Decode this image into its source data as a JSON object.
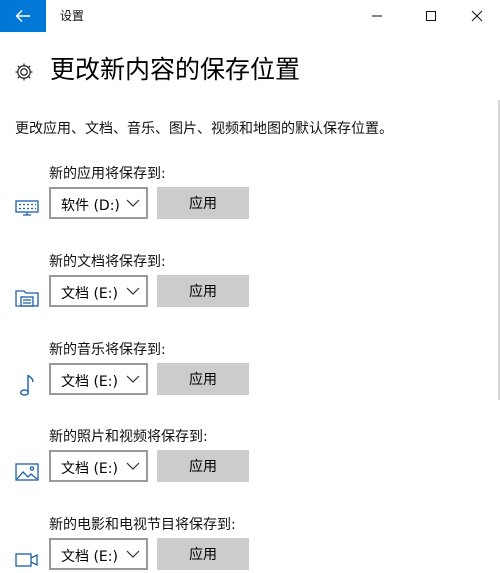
{
  "window": {
    "title": "设置",
    "controls": [
      "minimize-icon",
      "maximize-icon",
      "close-icon"
    ]
  },
  "page": {
    "title": "更改新内容的保存位置",
    "description": "更改应用、文档、音乐、图片、视频和地图的默认保存位置。"
  },
  "sections": [
    {
      "label": "新的应用将保存到:",
      "drive": "软件 (D:)",
      "apply": "应用",
      "icon": "monitor-icon"
    },
    {
      "label": "新的文档将保存到:",
      "drive": "文档 (E:)",
      "apply": "应用",
      "icon": "documents-folder-icon"
    },
    {
      "label": "新的音乐将保存到:",
      "drive": "文档 (E:)",
      "apply": "应用",
      "icon": "music-note-icon"
    },
    {
      "label": "新的照片和视频将保存到:",
      "drive": "文档 (E:)",
      "apply": "应用",
      "icon": "picture-icon"
    },
    {
      "label": "新的电影和电视节目将保存到:",
      "drive": "文档 (E:)",
      "apply": "应用",
      "icon": "video-camera-icon"
    }
  ],
  "colors": {
    "accent": "#0078d7",
    "button": "#cccccc",
    "border": "#999999"
  }
}
